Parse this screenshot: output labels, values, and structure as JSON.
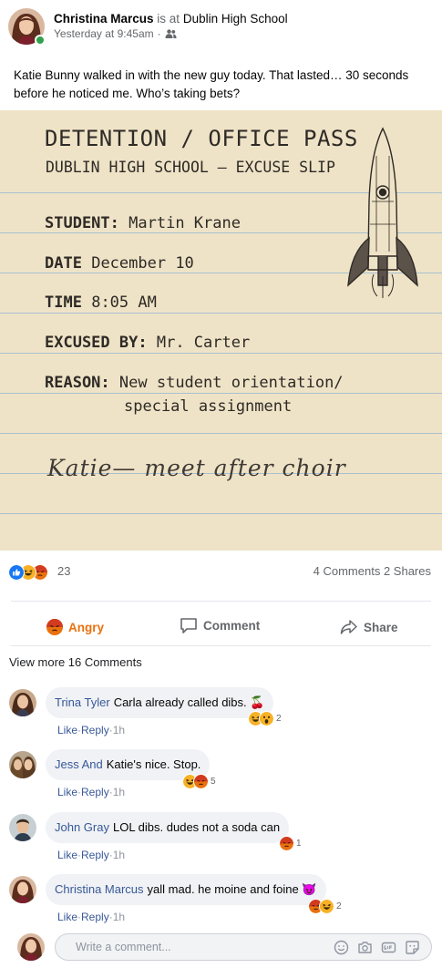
{
  "post": {
    "author": "Christina Marcus",
    "is_at": "is at",
    "location": "Dublin High School",
    "timestamp": "Yesterday at 9:45am",
    "separator": "·",
    "audience_icon": "friends-icon",
    "text": "Katie Bunny walked in with the new guy today. That lasted… 30 seconds before he noticed me. Who’s taking bets?"
  },
  "image": {
    "title": "DETENTION / OFFICE PASS",
    "subtitle": "DUBLIN HIGH SCHOOL — EXCUSE SLIP",
    "student_label": "STUDENT:",
    "student_value": "Martin Krane",
    "date_label": "DATE",
    "date_value": "December 10",
    "time_label": "TIME",
    "time_value": "8:05 AM",
    "excused_label": "EXCUSED BY:",
    "excused_value": "Mr. Carter",
    "reason_label": "REASON:",
    "reason_line1": "New student orientation/",
    "reason_line2": "special assignment",
    "handwritten_note": "Katie— meet after choir",
    "illustration": "rocket",
    "paper_color": "#efe3c7",
    "rule_color": "#a9c0cf"
  },
  "stats": {
    "reaction_icons": [
      "like-icon",
      "laugh-icon",
      "angry-icon"
    ],
    "reaction_count": "23",
    "comments": "4 Comments",
    "shares": "2 Shares"
  },
  "actions": {
    "angry": "Angry",
    "comment": "Comment",
    "share": "Share"
  },
  "view_more": "View more 16 Comments",
  "comments": [
    {
      "name": "Trina Tyler",
      "text": "Carla already called dibs. 🍒",
      "reactions": [
        "laugh-icon",
        "wow-icon"
      ],
      "count": "2",
      "like": "Like",
      "reply": "Reply",
      "time": "1h"
    },
    {
      "name": "Jess And",
      "text": "Katie's nice. Stop.",
      "reactions": [
        "laugh-icon",
        "angry-icon"
      ],
      "count": "5",
      "like": "Like",
      "reply": "Reply",
      "time": "1h"
    },
    {
      "name": "John Gray",
      "text": "LOL dibs. dudes not a soda can",
      "reactions": [
        "angry-icon"
      ],
      "count": "1",
      "like": "Like",
      "reply": "Reply",
      "time": "1h"
    },
    {
      "name": "Christina Marcus",
      "text": "yall mad. he moine and foine 😈",
      "reactions": [
        "angry-icon",
        "laugh-icon"
      ],
      "count": "2",
      "like": "Like",
      "reply": "Reply",
      "time": "1h"
    }
  ],
  "composer": {
    "placeholder": "Write a comment...",
    "icons": [
      "emoji-icon",
      "camera-icon",
      "gif-icon",
      "sticker-icon"
    ]
  },
  "colors": {
    "link": "#385898",
    "angry": "#e9710f",
    "online": "#31a24c",
    "like_blue": "#1877f2",
    "bubble": "#f0f2f5"
  }
}
